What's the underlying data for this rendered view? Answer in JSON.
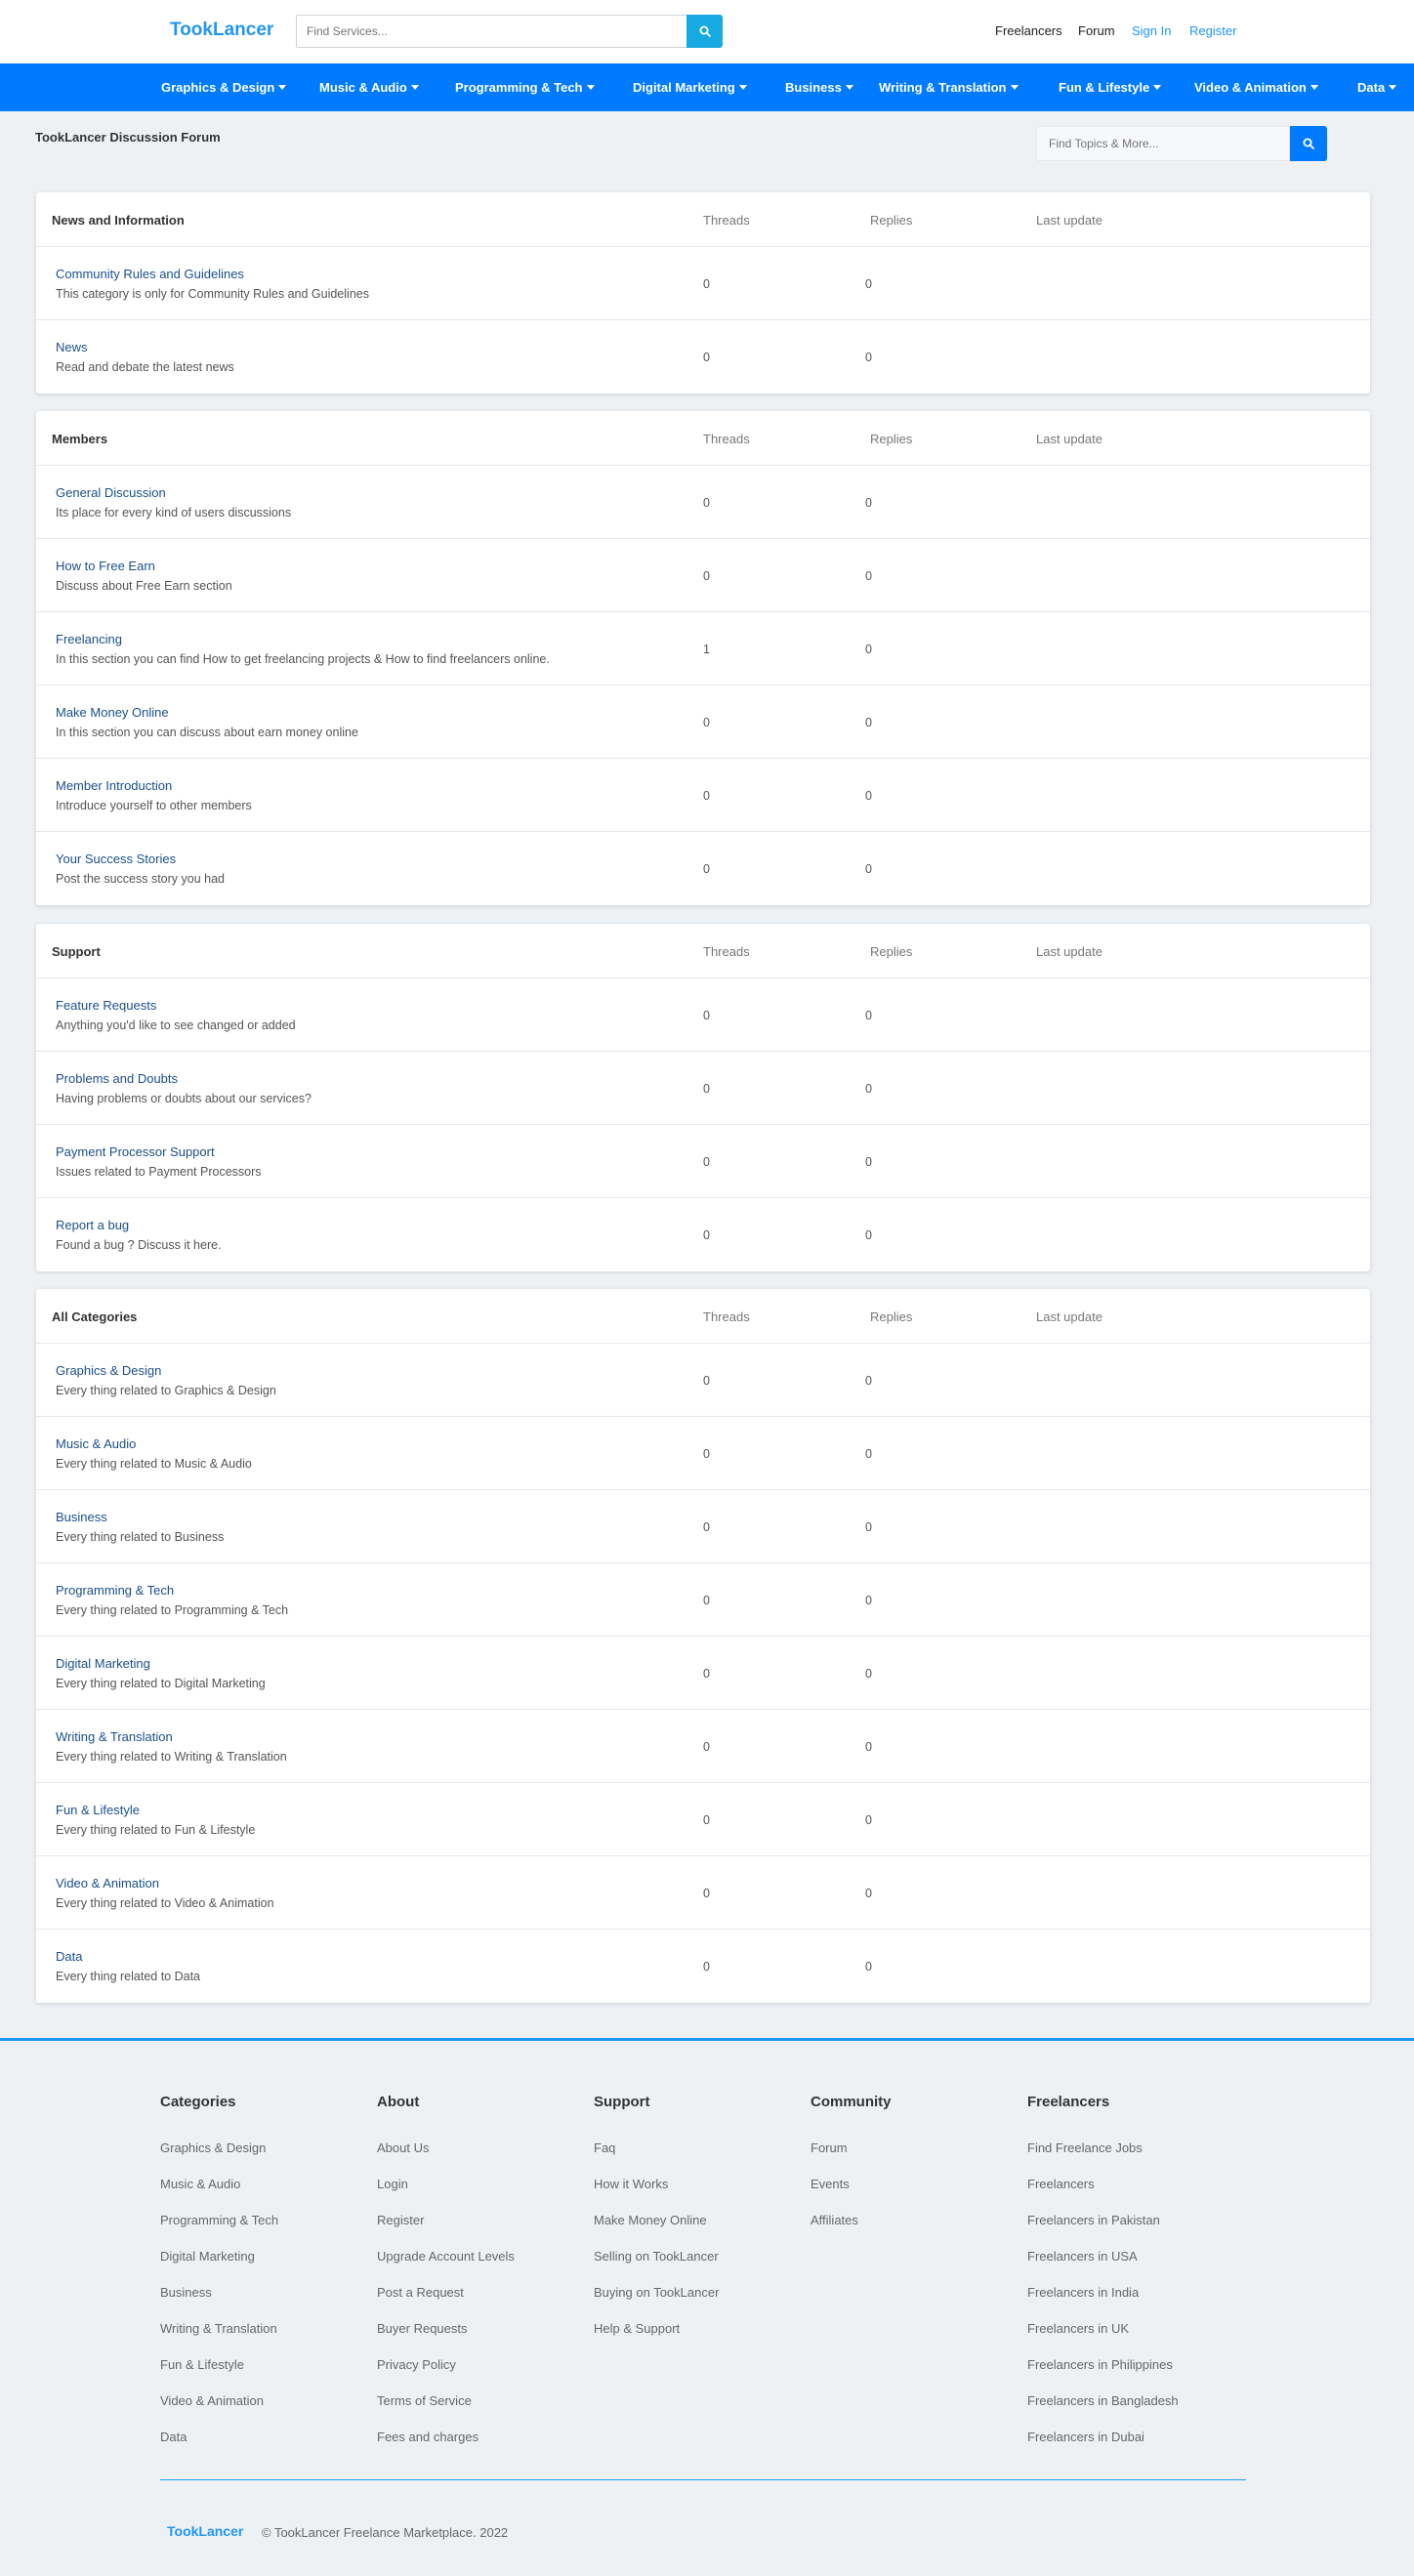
{
  "header": {
    "logo": "TookLancer",
    "search_placeholder": "Find Services...",
    "links": [
      {
        "label": "Freelancers",
        "color": "#222222"
      },
      {
        "label": "Forum",
        "color": "#222222"
      },
      {
        "label": "Sign In",
        "color": "#2196f3"
      },
      {
        "label": "Register",
        "color": "#2196f3"
      }
    ]
  },
  "categories_nav": [
    "Graphics & Design",
    "Music & Audio",
    "Programming & Tech",
    "Digital Marketing",
    "Business",
    "Writing & Translation",
    "Fun & Lifestyle",
    "Video & Animation",
    "Data"
  ],
  "forum": {
    "title": "TookLancer Discussion Forum",
    "search_placeholder": "Find Topics & More...",
    "columns": {
      "threads": "Threads",
      "replies": "Replies",
      "last_update": "Last update"
    },
    "sections": [
      {
        "title": "News and Information",
        "rows": [
          {
            "title": "Community Rules and Guidelines",
            "desc": "This category is only for Community Rules and Guidelines",
            "threads": "0",
            "replies": "0"
          },
          {
            "title": "News",
            "desc": "Read and debate the latest news",
            "threads": "0",
            "replies": "0"
          }
        ]
      },
      {
        "title": "Members",
        "rows": [
          {
            "title": "General Discussion",
            "desc": "Its place for every kind of users discussions",
            "threads": "0",
            "replies": "0"
          },
          {
            "title": "How to Free Earn",
            "desc": "Discuss about Free Earn section",
            "threads": "0",
            "replies": "0"
          },
          {
            "title": "Freelancing",
            "desc": "In this section you can find How to get freelancing projects & How to find freelancers online.",
            "threads": "1",
            "replies": "0"
          },
          {
            "title": "Make Money Online",
            "desc": "In this section you can discuss about earn money online",
            "threads": "0",
            "replies": "0"
          },
          {
            "title": "Member Introduction",
            "desc": "Introduce yourself to other members",
            "threads": "0",
            "replies": "0"
          },
          {
            "title": "Your Success Stories",
            "desc": "Post the success story you had",
            "threads": "0",
            "replies": "0"
          }
        ]
      },
      {
        "title": "Support",
        "rows": [
          {
            "title": "Feature Requests",
            "desc": "Anything you'd like to see changed or added",
            "threads": "0",
            "replies": "0"
          },
          {
            "title": "Problems and Doubts",
            "desc": "Having problems or doubts about our services?",
            "threads": "0",
            "replies": "0"
          },
          {
            "title": "Payment Processor Support",
            "desc": "Issues related to Payment Processors",
            "threads": "0",
            "replies": "0"
          },
          {
            "title": "Report a bug",
            "desc": "Found a bug ? Discuss it here.",
            "threads": "0",
            "replies": "0"
          }
        ]
      },
      {
        "title": "All Categories",
        "rows": [
          {
            "title": "Graphics & Design",
            "desc": "Every thing related to Graphics & Design",
            "threads": "0",
            "replies": "0"
          },
          {
            "title": "Music & Audio",
            "desc": "Every thing related to Music & Audio",
            "threads": "0",
            "replies": "0"
          },
          {
            "title": "Business",
            "desc": "Every thing related to Business",
            "threads": "0",
            "replies": "0"
          },
          {
            "title": "Programming & Tech",
            "desc": "Every thing related to Programming & Tech",
            "threads": "0",
            "replies": "0"
          },
          {
            "title": "Digital Marketing",
            "desc": "Every thing related to Digital Marketing",
            "threads": "0",
            "replies": "0"
          },
          {
            "title": "Writing & Translation",
            "desc": "Every thing related to Writing & Translation",
            "threads": "0",
            "replies": "0"
          },
          {
            "title": "Fun & Lifestyle",
            "desc": "Every thing related to Fun & Lifestyle",
            "threads": "0",
            "replies": "0"
          },
          {
            "title": "Video & Animation",
            "desc": "Every thing related to Video & Animation",
            "threads": "0",
            "replies": "0"
          },
          {
            "title": "Data",
            "desc": "Every thing related to Data",
            "threads": "0",
            "replies": "0"
          }
        ]
      }
    ]
  },
  "footer": {
    "columns": [
      {
        "title": "Categories",
        "links": [
          "Graphics & Design",
          "Music & Audio",
          "Programming & Tech",
          "Digital Marketing",
          "Business",
          "Writing & Translation",
          "Fun & Lifestyle",
          "Video & Animation",
          "Data"
        ]
      },
      {
        "title": "About",
        "links": [
          "About Us",
          "Login",
          "Register",
          "Upgrade Account Levels",
          "Post a Request",
          "Buyer Requests",
          "Privacy Policy",
          "Terms of Service",
          "Fees and charges"
        ]
      },
      {
        "title": "Support",
        "links": [
          "Faq",
          "How it Works",
          "Make Money Online",
          "Selling on TookLancer",
          "Buying on TookLancer",
          "Help & Support"
        ]
      },
      {
        "title": "Community",
        "links": [
          "Forum",
          "Events",
          "Affiliates"
        ]
      },
      {
        "title": "Freelancers",
        "links": [
          "Find Freelance Jobs",
          "Freelancers",
          "Freelancers in Pakistan",
          "Freelancers in USA",
          "Freelancers in India",
          "Freelancers in UK",
          "Freelancers in Philippines",
          "Freelancers in Bangladesh",
          "Freelancers in Dubai"
        ]
      }
    ],
    "logo": "TookLancer",
    "copyright": "© TookLancer Freelance Marketplace. 2022"
  },
  "colors": {
    "primary": "#007bff",
    "brand": "#2196f3",
    "search_accent": "#17a9e1",
    "link": "#1b4f8a"
  }
}
